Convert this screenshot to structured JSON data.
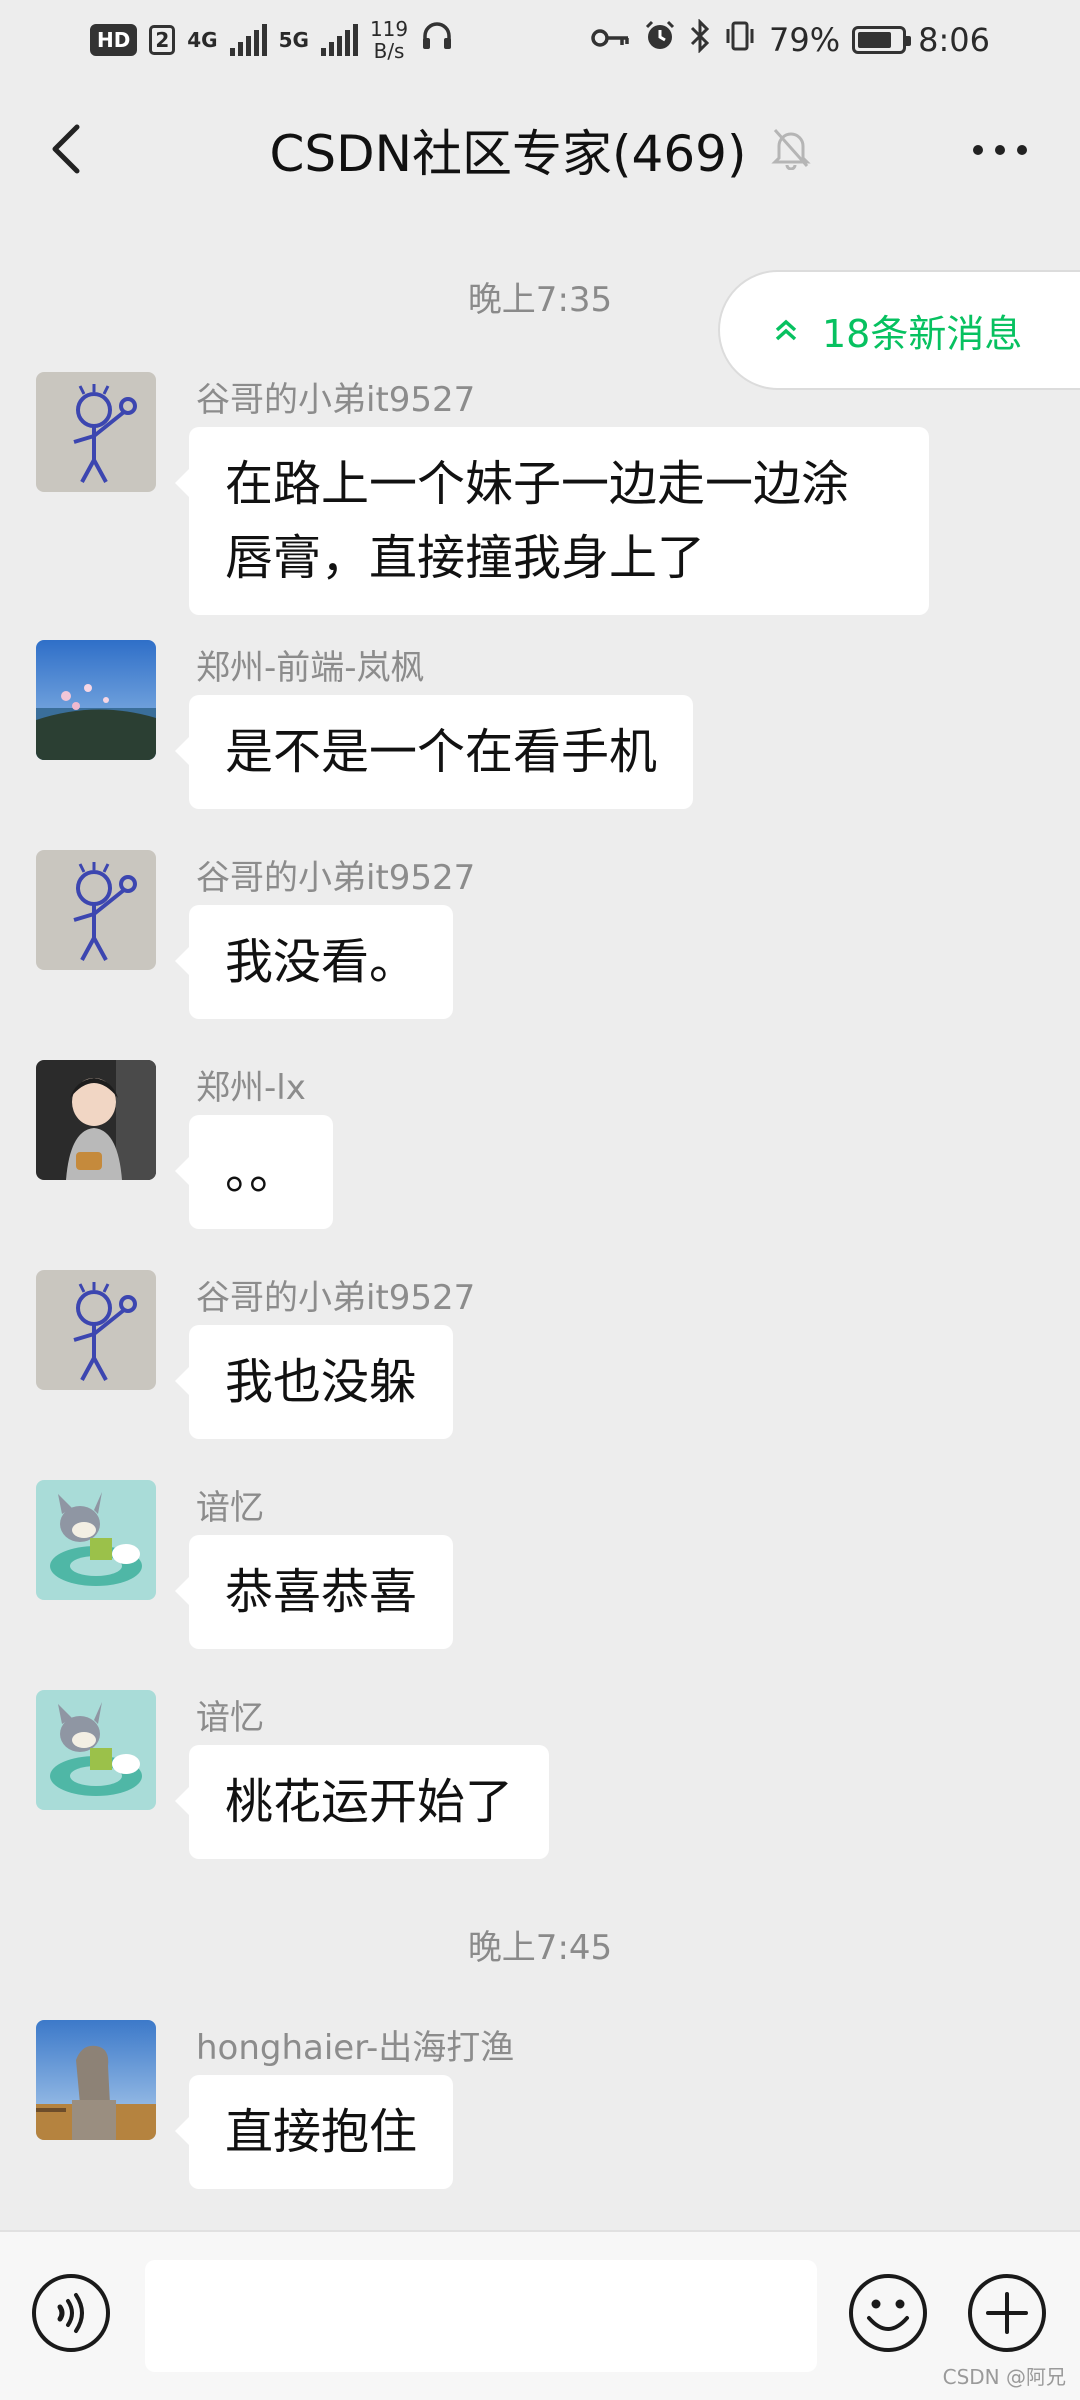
{
  "status_bar": {
    "hd": "HD",
    "sim": "2",
    "net1": "4G",
    "net2": "5G",
    "speed_value": "119",
    "speed_unit": "B/s",
    "battery": "79%",
    "time": "8:06"
  },
  "header": {
    "title": "CSDN社区专家(469)",
    "muted": true
  },
  "new_messages": {
    "label": "18条新消息",
    "color": "#07c160"
  },
  "timestamps": [
    "晚上7:35",
    "晚上7:45"
  ],
  "messages": [
    {
      "sender": "谷哥的小弟it9527",
      "text": "在路上一个妹子一边走一边涂唇膏，直接撞我身上了",
      "avatar": "stick-figure-avatar"
    },
    {
      "sender": "郑州-前端-岚枫",
      "text": "是不是一个在看手机",
      "avatar": "lake-flowers-avatar"
    },
    {
      "sender": "谷哥的小弟it9527",
      "text": "我没看。",
      "avatar": "stick-figure-avatar"
    },
    {
      "sender": "郑州-lx",
      "text": "。。",
      "avatar": "child-photo-avatar"
    },
    {
      "sender": "谷哥的小弟it9527",
      "text": "我也没躲",
      "avatar": "stick-figure-avatar"
    },
    {
      "sender": "谙忆",
      "text": "恭喜恭喜",
      "avatar": "cartoon-cat-avatar"
    },
    {
      "sender": "谙忆",
      "text": "桃花运开始了",
      "avatar": "cartoon-cat-avatar"
    },
    {
      "sender": "honghaier-出海打渔",
      "text": "直接抱住",
      "avatar": "stone-lion-avatar"
    }
  ],
  "input": {
    "value": "",
    "placeholder": ""
  },
  "watermark": "CSDN @阿兄"
}
